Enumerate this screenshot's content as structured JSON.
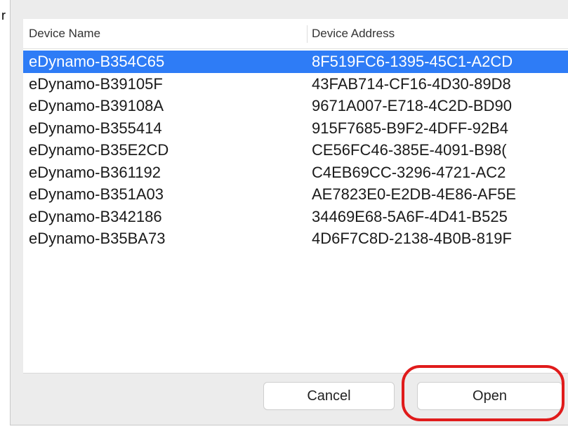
{
  "table": {
    "columns": [
      "Device Name",
      "Device Address"
    ],
    "selected_index": 0,
    "rows": [
      {
        "name": "eDynamo-B354C65",
        "address": "8F519FC6-1395-45C1-A2CD"
      },
      {
        "name": "eDynamo-B39105F",
        "address": "43FAB714-CF16-4D30-89D8"
      },
      {
        "name": "eDynamo-B39108A",
        "address": "9671A007-E718-4C2D-BD90"
      },
      {
        "name": "eDynamo-B355414",
        "address": "915F7685-B9F2-4DFF-92B4"
      },
      {
        "name": "eDynamo-B35E2CD",
        "address": "CE56FC46-385E-4091-B98("
      },
      {
        "name": "eDynamo-B361192",
        "address": "C4EB69CC-3296-4721-AC2"
      },
      {
        "name": "eDynamo-B351A03",
        "address": "AE7823E0-E2DB-4E86-AF5E"
      },
      {
        "name": "eDynamo-B342186",
        "address": "34469E68-5A6F-4D41-B525"
      },
      {
        "name": "eDynamo-B35BA73",
        "address": "4D6F7C8D-2138-4B0B-819F"
      }
    ]
  },
  "buttons": {
    "cancel": "Cancel",
    "open": "Open"
  },
  "colors": {
    "selection": "#2e7cf6",
    "annotation": "#e01b1b",
    "dialog_background": "#ececec"
  },
  "left_fragment": "r"
}
